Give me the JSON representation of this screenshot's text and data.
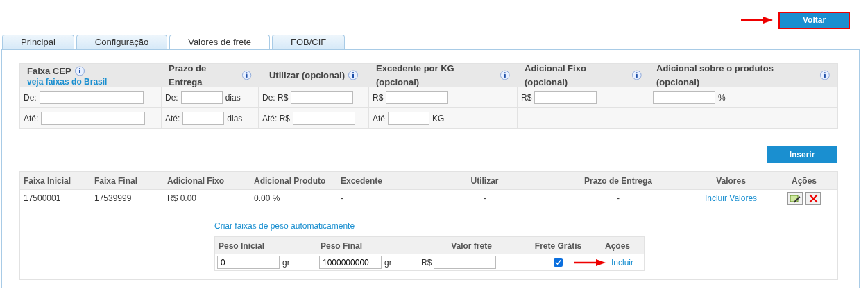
{
  "back_button": {
    "label": "Voltar",
    "highlighted": true
  },
  "tabs": [
    {
      "label": "Principal",
      "selected": false
    },
    {
      "label": "Configuração",
      "selected": false
    },
    {
      "label": "Valores de frete",
      "selected": true
    },
    {
      "label": "FOB/CIF",
      "selected": false
    }
  ],
  "filter": {
    "columns": [
      {
        "label": "Faixa CEP",
        "link": "veja faixas do Brasil"
      },
      {
        "label": "Prazo de Entrega"
      },
      {
        "label": "Utilizar (opcional)"
      },
      {
        "label": "Excedente por KG (opcional)"
      },
      {
        "label": "Adicional Fixo (opcional)"
      },
      {
        "label": "Adicional sobre o produtos (opcional)"
      }
    ],
    "rows": [
      [
        {
          "prefix": "De:"
        },
        {
          "prefix": "De:",
          "suffix": "dias"
        },
        {
          "prefix": "De: R$"
        },
        {
          "prefix": "R$"
        },
        {
          "prefix": "R$"
        },
        {
          "suffix": "%"
        }
      ],
      [
        {
          "prefix": "Até:"
        },
        {
          "prefix": "Até:",
          "suffix": "dias"
        },
        {
          "prefix": "Até: R$"
        },
        {
          "prefix": "Até",
          "suffix": "KG"
        },
        null,
        null
      ]
    ]
  },
  "insert_button": "Inserir",
  "table": {
    "columns": [
      "Faixa Inicial",
      "Faixa Final",
      "Adicional Fixo",
      "Adicional Produto",
      "Excedente",
      "Utilizar",
      "Prazo de Entrega",
      "Valores",
      "Ações"
    ],
    "rows": [
      {
        "cells": [
          "17500001",
          "17539999",
          "R$ 0.00",
          "0.00 %",
          "-",
          "-",
          "-"
        ],
        "link": "Incluir Valores"
      }
    ]
  },
  "weight": {
    "link": "Criar faixas de peso automaticamente",
    "columns": [
      "Peso Inicial",
      "Peso Final",
      "Valor frete",
      "Frete Grátis",
      "Ações"
    ],
    "initial": "0",
    "initial_unit": "gr",
    "final": "1000000000",
    "final_unit": "gr",
    "value_prefix": "R$",
    "free_shipping": true,
    "action": "Incluir"
  }
}
